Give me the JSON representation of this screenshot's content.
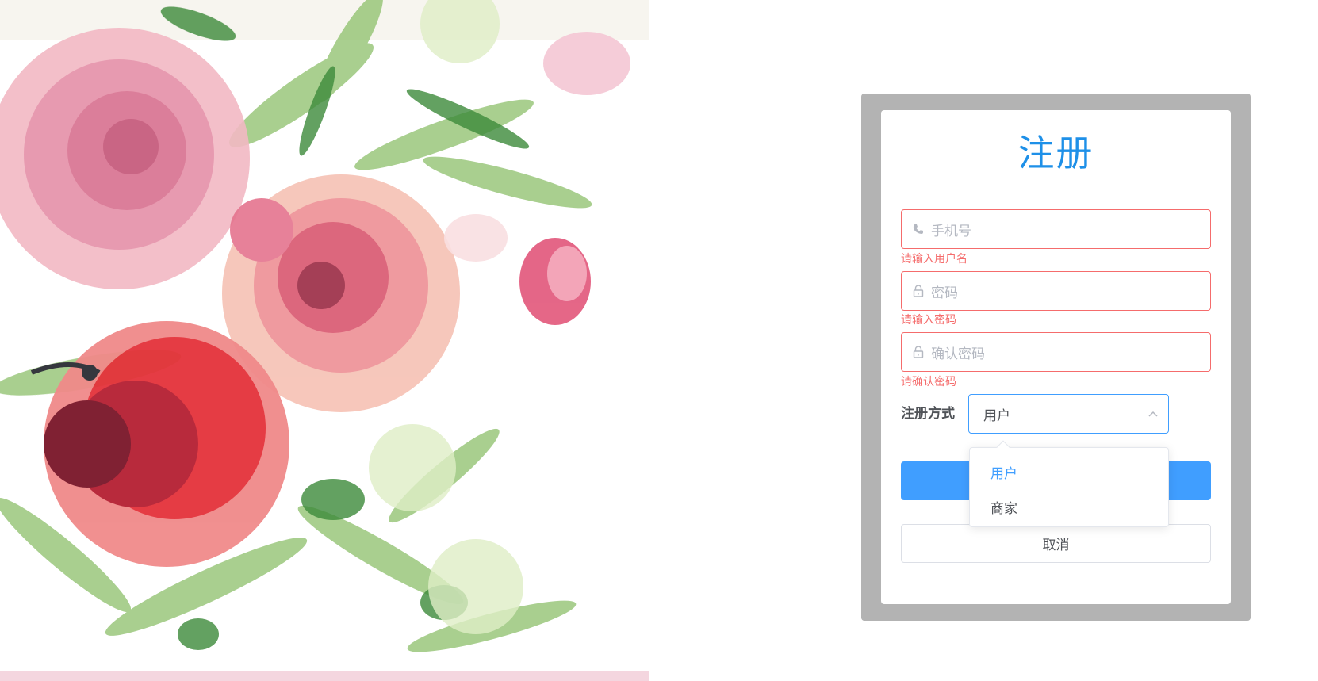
{
  "register": {
    "title": "注册",
    "phone_placeholder": "手机号",
    "phone_error": "请输入用户名",
    "password_placeholder": "密码",
    "password_error": "请输入密码",
    "confirm_placeholder": "确认密码",
    "confirm_error": "请确认密码",
    "method_label": "注册方式",
    "method_value": "用户",
    "cancel_label": "取消"
  },
  "dropdown": {
    "options": [
      "用户",
      "商家"
    ],
    "selected_index": 0
  },
  "icons": {
    "phone": "phone-icon",
    "password": "lock-icon",
    "confirm": "lock-icon",
    "select": "chevron-up-icon"
  },
  "colors": {
    "title": "#1e90e8",
    "error": "#f56c6c",
    "primary": "#409eff"
  }
}
